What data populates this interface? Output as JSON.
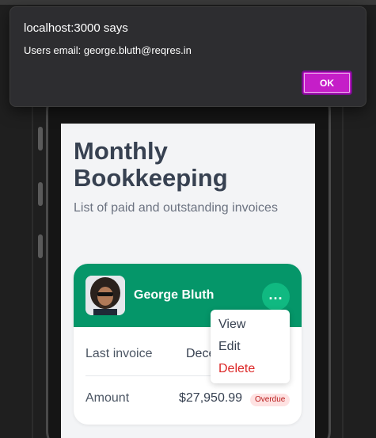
{
  "dialog": {
    "title": "localhost:3000 says",
    "message": "Users email: george.bluth@reqres.in",
    "ok_label": "OK"
  },
  "page": {
    "title": "Monthly Bookkeeping",
    "subtitle": "List of paid and outstanding invoices"
  },
  "card": {
    "user_name": "George Bluth",
    "more_label": "...",
    "last_invoice_label": "Last invoice",
    "last_invoice_value": "Dece",
    "amount_label": "Amount",
    "amount_value": "$27,950.99",
    "status_badge": "Overdue"
  },
  "menu": {
    "items": [
      {
        "label": "View"
      },
      {
        "label": "Edit"
      },
      {
        "label": "Delete"
      }
    ]
  },
  "colors": {
    "header_green": "#059669",
    "dialog_bg": "#2d2d30",
    "ok_button": "#c51ec8",
    "delete_red": "#dc2626",
    "overdue_bg": "#fee2e2"
  }
}
